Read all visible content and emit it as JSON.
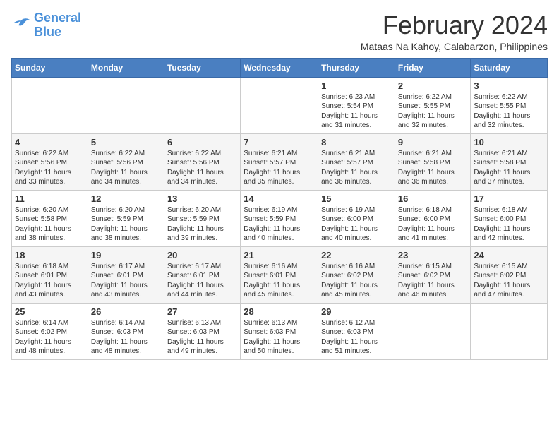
{
  "logo": {
    "line1": "General",
    "line2": "Blue"
  },
  "title": "February 2024",
  "subtitle": "Mataas Na Kahoy, Calabarzon, Philippines",
  "days_header": [
    "Sunday",
    "Monday",
    "Tuesday",
    "Wednesday",
    "Thursday",
    "Friday",
    "Saturday"
  ],
  "weeks": [
    [
      {
        "day": "",
        "info": ""
      },
      {
        "day": "",
        "info": ""
      },
      {
        "day": "",
        "info": ""
      },
      {
        "day": "",
        "info": ""
      },
      {
        "day": "1",
        "info": "Sunrise: 6:23 AM\nSunset: 5:54 PM\nDaylight: 11 hours\nand 31 minutes."
      },
      {
        "day": "2",
        "info": "Sunrise: 6:22 AM\nSunset: 5:55 PM\nDaylight: 11 hours\nand 32 minutes."
      },
      {
        "day": "3",
        "info": "Sunrise: 6:22 AM\nSunset: 5:55 PM\nDaylight: 11 hours\nand 32 minutes."
      }
    ],
    [
      {
        "day": "4",
        "info": "Sunrise: 6:22 AM\nSunset: 5:56 PM\nDaylight: 11 hours\nand 33 minutes."
      },
      {
        "day": "5",
        "info": "Sunrise: 6:22 AM\nSunset: 5:56 PM\nDaylight: 11 hours\nand 34 minutes."
      },
      {
        "day": "6",
        "info": "Sunrise: 6:22 AM\nSunset: 5:56 PM\nDaylight: 11 hours\nand 34 minutes."
      },
      {
        "day": "7",
        "info": "Sunrise: 6:21 AM\nSunset: 5:57 PM\nDaylight: 11 hours\nand 35 minutes."
      },
      {
        "day": "8",
        "info": "Sunrise: 6:21 AM\nSunset: 5:57 PM\nDaylight: 11 hours\nand 36 minutes."
      },
      {
        "day": "9",
        "info": "Sunrise: 6:21 AM\nSunset: 5:58 PM\nDaylight: 11 hours\nand 36 minutes."
      },
      {
        "day": "10",
        "info": "Sunrise: 6:21 AM\nSunset: 5:58 PM\nDaylight: 11 hours\nand 37 minutes."
      }
    ],
    [
      {
        "day": "11",
        "info": "Sunrise: 6:20 AM\nSunset: 5:58 PM\nDaylight: 11 hours\nand 38 minutes."
      },
      {
        "day": "12",
        "info": "Sunrise: 6:20 AM\nSunset: 5:59 PM\nDaylight: 11 hours\nand 38 minutes."
      },
      {
        "day": "13",
        "info": "Sunrise: 6:20 AM\nSunset: 5:59 PM\nDaylight: 11 hours\nand 39 minutes."
      },
      {
        "day": "14",
        "info": "Sunrise: 6:19 AM\nSunset: 5:59 PM\nDaylight: 11 hours\nand 40 minutes."
      },
      {
        "day": "15",
        "info": "Sunrise: 6:19 AM\nSunset: 6:00 PM\nDaylight: 11 hours\nand 40 minutes."
      },
      {
        "day": "16",
        "info": "Sunrise: 6:18 AM\nSunset: 6:00 PM\nDaylight: 11 hours\nand 41 minutes."
      },
      {
        "day": "17",
        "info": "Sunrise: 6:18 AM\nSunset: 6:00 PM\nDaylight: 11 hours\nand 42 minutes."
      }
    ],
    [
      {
        "day": "18",
        "info": "Sunrise: 6:18 AM\nSunset: 6:01 PM\nDaylight: 11 hours\nand 43 minutes."
      },
      {
        "day": "19",
        "info": "Sunrise: 6:17 AM\nSunset: 6:01 PM\nDaylight: 11 hours\nand 43 minutes."
      },
      {
        "day": "20",
        "info": "Sunrise: 6:17 AM\nSunset: 6:01 PM\nDaylight: 11 hours\nand 44 minutes."
      },
      {
        "day": "21",
        "info": "Sunrise: 6:16 AM\nSunset: 6:01 PM\nDaylight: 11 hours\nand 45 minutes."
      },
      {
        "day": "22",
        "info": "Sunrise: 6:16 AM\nSunset: 6:02 PM\nDaylight: 11 hours\nand 45 minutes."
      },
      {
        "day": "23",
        "info": "Sunrise: 6:15 AM\nSunset: 6:02 PM\nDaylight: 11 hours\nand 46 minutes."
      },
      {
        "day": "24",
        "info": "Sunrise: 6:15 AM\nSunset: 6:02 PM\nDaylight: 11 hours\nand 47 minutes."
      }
    ],
    [
      {
        "day": "25",
        "info": "Sunrise: 6:14 AM\nSunset: 6:02 PM\nDaylight: 11 hours\nand 48 minutes."
      },
      {
        "day": "26",
        "info": "Sunrise: 6:14 AM\nSunset: 6:03 PM\nDaylight: 11 hours\nand 48 minutes."
      },
      {
        "day": "27",
        "info": "Sunrise: 6:13 AM\nSunset: 6:03 PM\nDaylight: 11 hours\nand 49 minutes."
      },
      {
        "day": "28",
        "info": "Sunrise: 6:13 AM\nSunset: 6:03 PM\nDaylight: 11 hours\nand 50 minutes."
      },
      {
        "day": "29",
        "info": "Sunrise: 6:12 AM\nSunset: 6:03 PM\nDaylight: 11 hours\nand 51 minutes."
      },
      {
        "day": "",
        "info": ""
      },
      {
        "day": "",
        "info": ""
      }
    ]
  ]
}
